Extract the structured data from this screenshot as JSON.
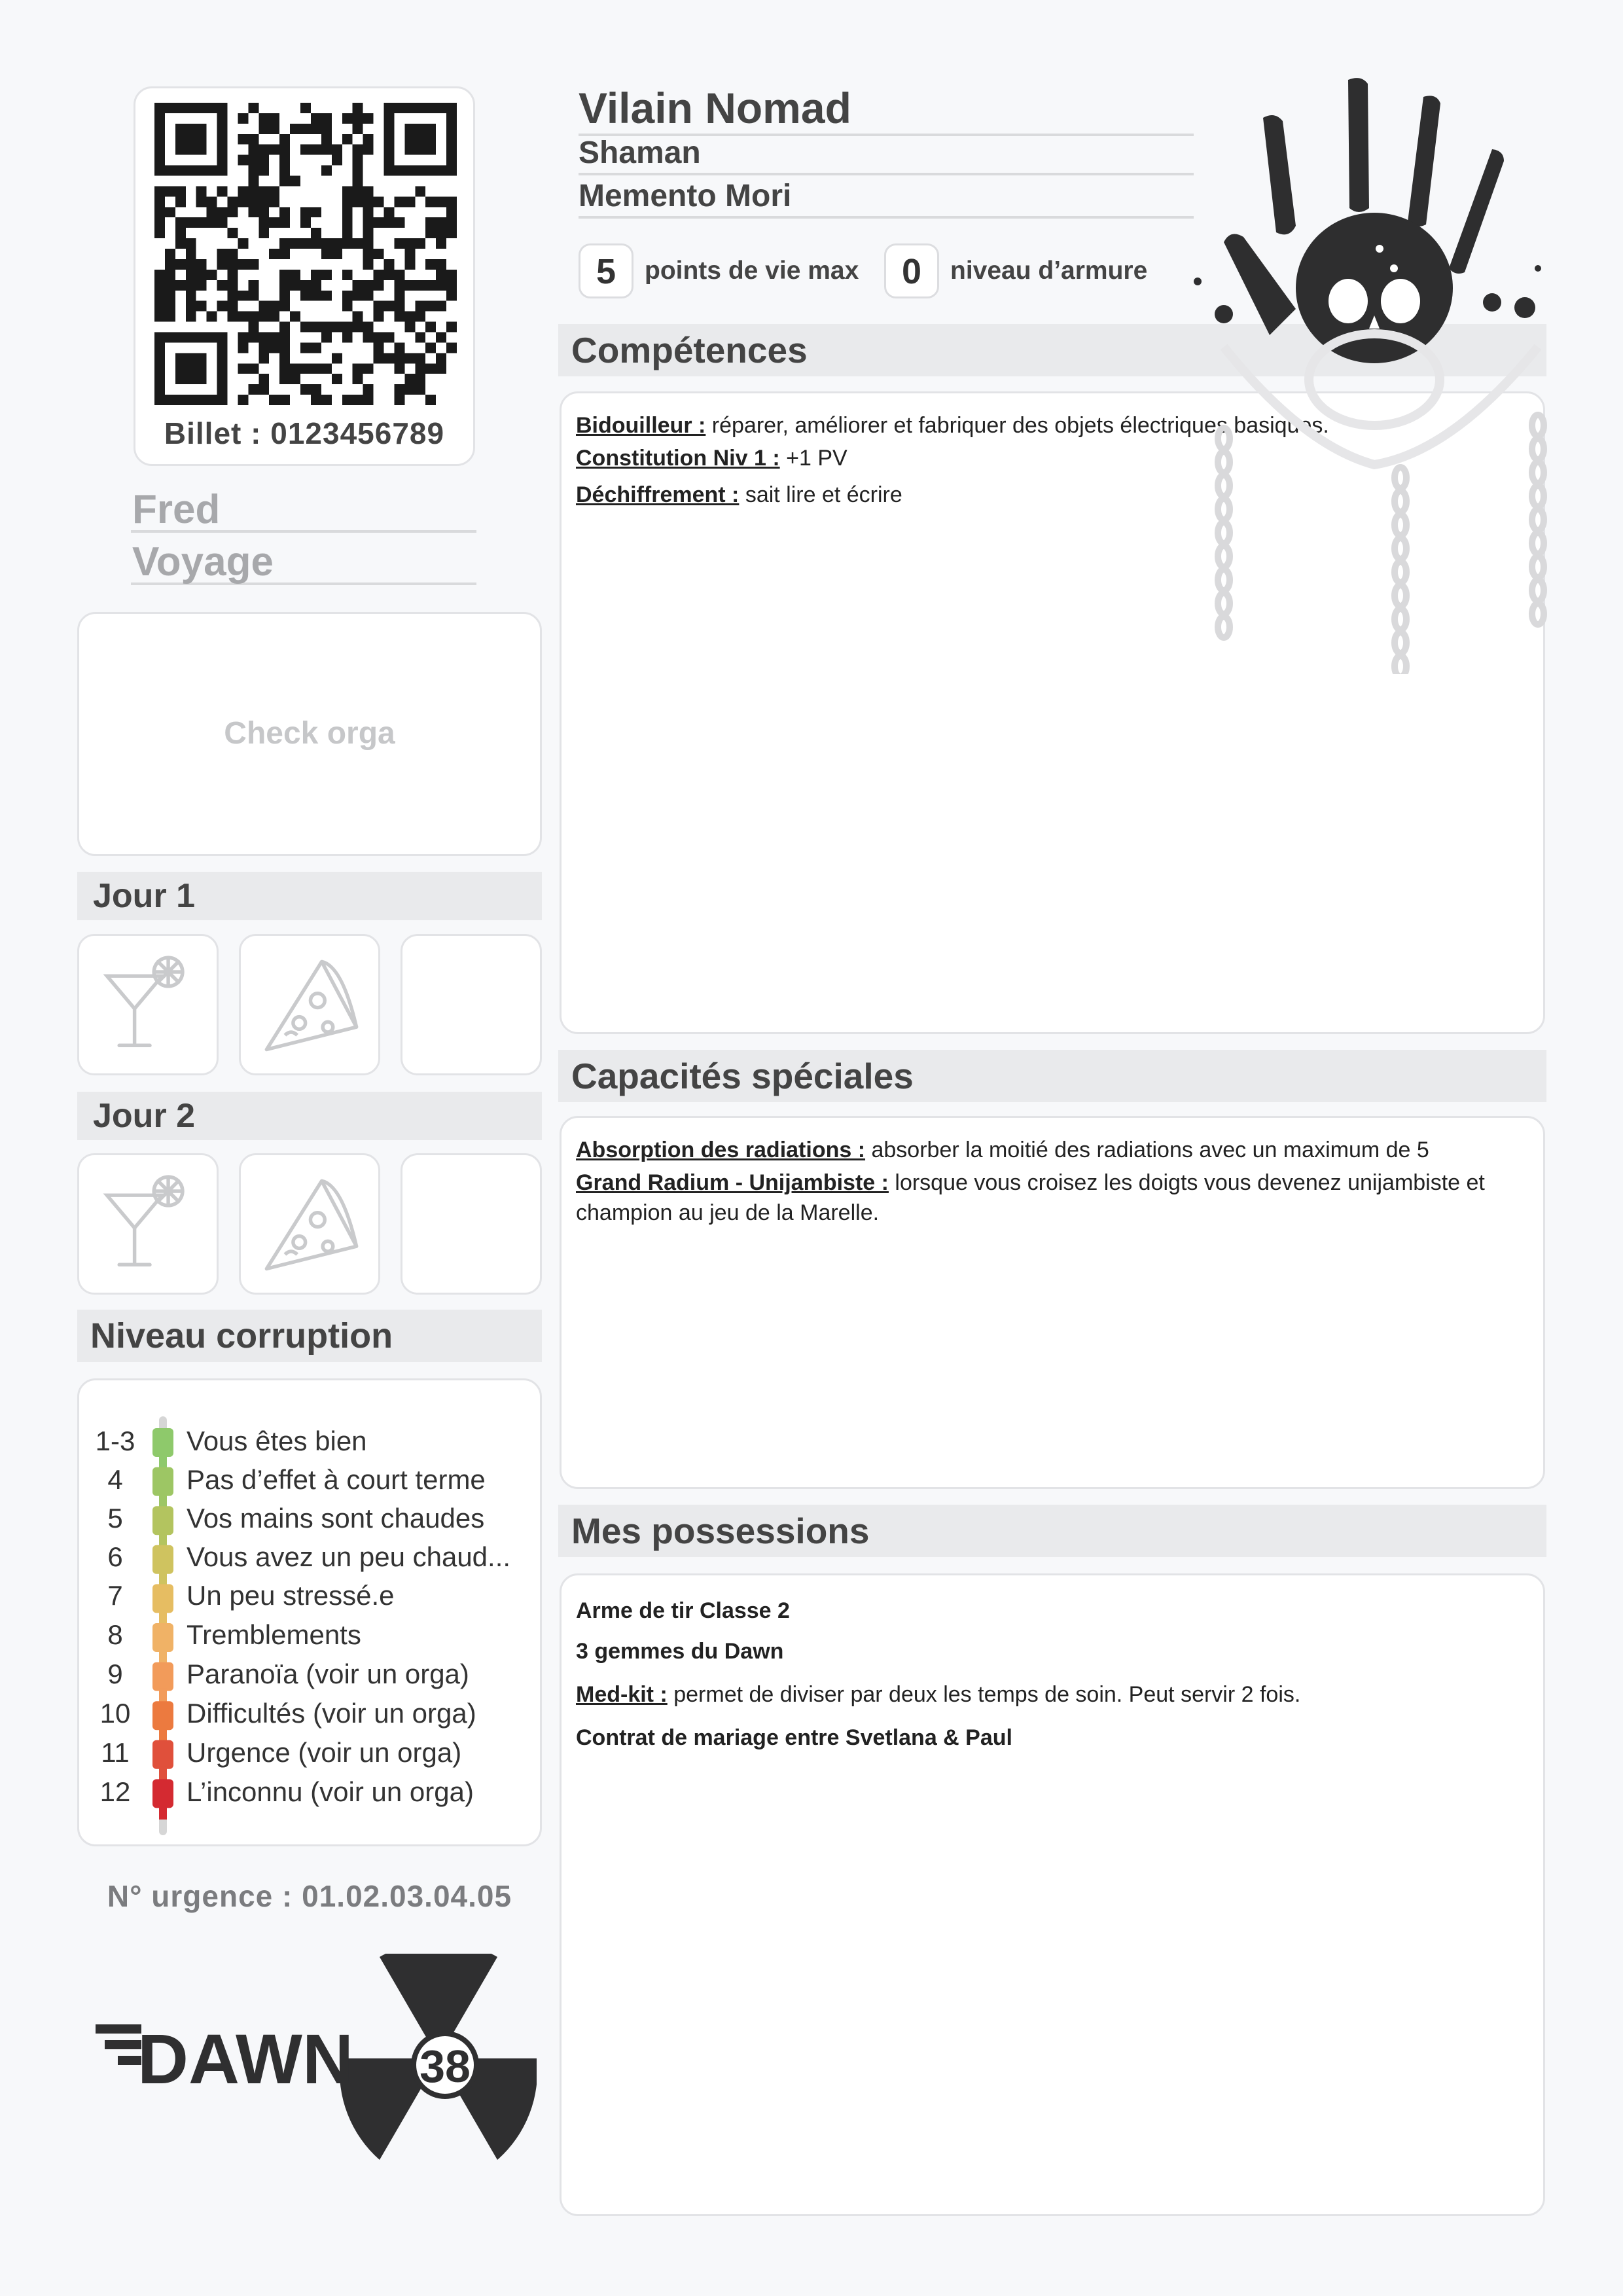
{
  "ticket": {
    "label": "Billet : 0123456789"
  },
  "player": {
    "name": "Fred",
    "travel": "Voyage"
  },
  "check": {
    "label": "Check orga"
  },
  "days": [
    {
      "label": "Jour 1",
      "slots": [
        "cocktail-icon",
        "pizza-icon",
        "empty"
      ]
    },
    {
      "label": "Jour 2",
      "slots": [
        "cocktail-icon",
        "pizza-icon",
        "empty"
      ]
    }
  ],
  "corruption": {
    "title": "Niveau corruption",
    "levels": [
      {
        "n": "1-3",
        "text": "Vous êtes bien",
        "color": "#8ec96b"
      },
      {
        "n": "4",
        "text": "Pas d’effet à court terme",
        "color": "#9dc664"
      },
      {
        "n": "5",
        "text": "Vos mains sont chaudes",
        "color": "#b3c45f"
      },
      {
        "n": "6",
        "text": "Vous avez un peu chaud...",
        "color": "#cfc35f"
      },
      {
        "n": "7",
        "text": "Un peu stressé.e",
        "color": "#e6bd62"
      },
      {
        "n": "8",
        "text": "Tremblements",
        "color": "#f0b266"
      },
      {
        "n": "9",
        "text": "Paranoïa (voir un orga)",
        "color": "#f29b5a"
      },
      {
        "n": "10",
        "text": "Difficultés (voir un orga)",
        "color": "#ec7a3f"
      },
      {
        "n": "11",
        "text": "Urgence (voir un orga)",
        "color": "#e0503b"
      },
      {
        "n": "12",
        "text": "L’inconnu (voir un orga)",
        "color": "#d42a31"
      }
    ]
  },
  "urgence": "N° urgence : 01.02.03.04.05",
  "logo": {
    "text": "DAWN",
    "number": "38"
  },
  "character": {
    "name": "Vilain Nomad",
    "class": "Shaman",
    "group": "Memento Mori",
    "hp": "5",
    "hp_label": "points de vie max",
    "armor": "0",
    "armor_label": "niveau d’armure"
  },
  "skills": {
    "title": "Compétences",
    "items": [
      {
        "name": "Bidouilleur :",
        "desc": " réparer, améliorer et fabriquer des objets électriques basiques."
      },
      {
        "name": "Constitution Niv 1 :",
        "desc": " +1 PV"
      },
      {
        "name": "Déchiffrement :",
        "desc": " sait lire et écrire"
      }
    ]
  },
  "abilities": {
    "title": "Capacités spéciales",
    "items": [
      {
        "name": "Absorption des radiations :",
        "desc": " absorber la moitié des radiations avec un maximum de 5"
      },
      {
        "name": "Grand Radium - Unijambiste :",
        "desc": " lorsque vous croisez les doigts vous devenez unijambiste et champion au jeu de la Marelle."
      }
    ]
  },
  "possessions": {
    "title": "Mes possessions",
    "item1": "Arme de tir Classe 2",
    "item2": "3 gemmes du Dawn",
    "medkit_name": "Med-kit :",
    "medkit_desc": " permet de diviser par deux les temps de soin. Peut servir 2 fois.",
    "item4": "Contrat de mariage entre Svetlana & Paul"
  }
}
